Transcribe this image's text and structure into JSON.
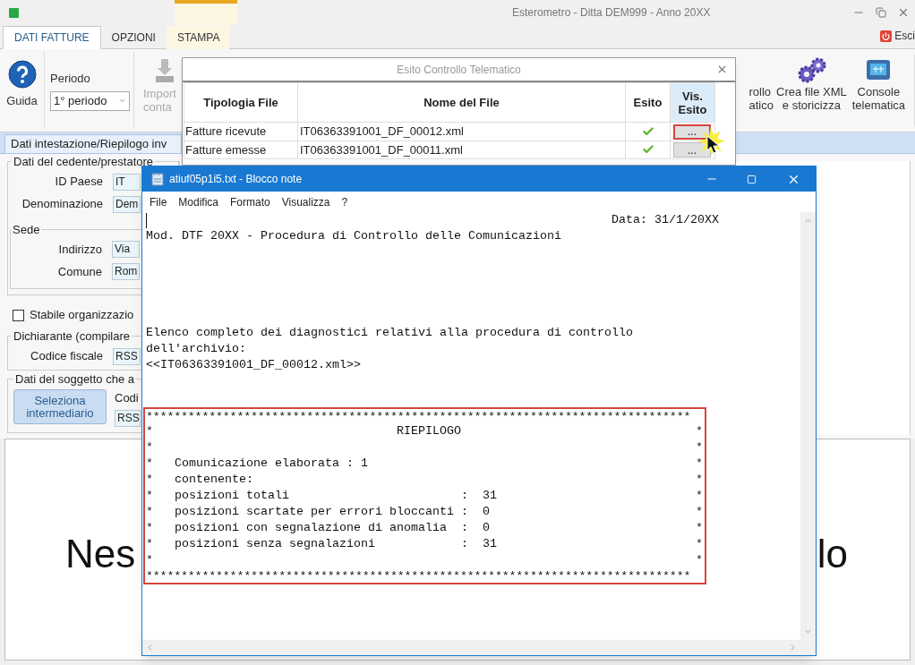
{
  "window": {
    "title": "Esterometro -  Ditta DEM999 - Anno 20XX"
  },
  "tabs": [
    {
      "label": "DATI FATTURE",
      "selected": true,
      "highlighted": false
    },
    {
      "label": "OPZIONI",
      "selected": false,
      "highlighted": false
    },
    {
      "label": "STAMPA",
      "selected": false,
      "highlighted": true
    }
  ],
  "exit_button": {
    "label": "Esci"
  },
  "ribbon": {
    "help": {
      "label": "Guida"
    },
    "period": {
      "label": "Periodo",
      "value": "1° periodo"
    },
    "import": {
      "lines": [
        "Import",
        "conta"
      ]
    },
    "partial": {
      "lines": [
        "rollo",
        "atico"
      ]
    },
    "buttons": [
      {
        "kind": "gears",
        "lines": [
          "Crea file XML",
          "e storicizza"
        ]
      },
      {
        "kind": "console",
        "lines": [
          "Console",
          "telematica"
        ]
      }
    ]
  },
  "section_tab": {
    "label": "Dati intestazione/Riepilogo inv"
  },
  "form": {
    "cedente": {
      "legend": "Dati del cedente/prestatore",
      "fields": [
        {
          "label": "ID Paese",
          "value": "IT"
        },
        {
          "label": "Denominazione",
          "value": "Dem"
        }
      ]
    },
    "sede": {
      "legend": "Sede",
      "fields": [
        {
          "label": "Indirizzo",
          "value": "Via"
        },
        {
          "label": "Comune",
          "value": "Rom"
        }
      ]
    },
    "stabile": {
      "label": "Stabile organizzazio",
      "checked": false
    },
    "dichiarante": {
      "legend": "Dichiarante (compilare",
      "fields": [
        {
          "label": "Codice fiscale",
          "value": "RSS"
        }
      ]
    },
    "soggetto": {
      "legend": "Dati del soggetto che a",
      "button": "Seleziona intermediario",
      "field_label": "Codi",
      "field_value": "RSS"
    }
  },
  "empty_message": {
    "left": "Nes",
    "right": "lo"
  },
  "dialog": {
    "title": "Esito Controllo Telematico",
    "columns": [
      "Tipologia File",
      "Nome del File",
      "Esito",
      "Vis. Esito"
    ],
    "rows": [
      {
        "type": "Fatture ricevute",
        "file": "IT06363391001_DF_00012.xml",
        "button": "...",
        "highlighted": true
      },
      {
        "type": "Fatture emesse",
        "file": "IT06363391001_DF_00011.xml",
        "button": "...",
        "highlighted": false
      }
    ]
  },
  "notepad": {
    "title": "atiuf05p1i5.txt - Blocco note",
    "menu": [
      "File",
      "Modifica",
      "Formato",
      "Visualizza",
      "?"
    ],
    "date_line": "Data: 31/1/20XX",
    "header": "Mod. DTF 20XX - Procedura di Controllo delle Comunicazioni",
    "intro": [
      "Elenco completo dei diagnostici relativi alla procedura di controllo",
      "dell'archivio:",
      "<<IT06363391001_DF_00012.xml>>"
    ],
    "summary": {
      "highlighted": true,
      "top_border": "******************************************************************************",
      "bottom_border": "******************************************************************************",
      "rows": [
        {
          "kind": "title",
          "left": "*",
          "text": "RIEPILOGO",
          "right": "*"
        },
        {
          "kind": "blank",
          "left": "*",
          "right": "*"
        },
        {
          "kind": "text",
          "left": "*",
          "text": "Comunicazione elaborata : 1",
          "right": "*"
        },
        {
          "kind": "text",
          "left": "*",
          "text": "contenente:",
          "right": "*"
        },
        {
          "kind": "pair",
          "left": "*",
          "label": "posizioni totali",
          "colon": ":",
          "value": "31",
          "right": "*"
        },
        {
          "kind": "pair",
          "left": "*",
          "label": "posizioni scartate per errori bloccanti",
          "colon": ":",
          "value": "0",
          "right": "*"
        },
        {
          "kind": "pair",
          "left": "*",
          "label": "posizioni con segnalazione di anomalia",
          "colon": ":",
          "value": "0",
          "right": "*"
        },
        {
          "kind": "pair",
          "left": "*",
          "label": "posizioni senza segnalazioni",
          "colon": ":",
          "value": "31",
          "right": "*"
        },
        {
          "kind": "blank",
          "left": "*",
          "right": "*"
        }
      ]
    }
  }
}
